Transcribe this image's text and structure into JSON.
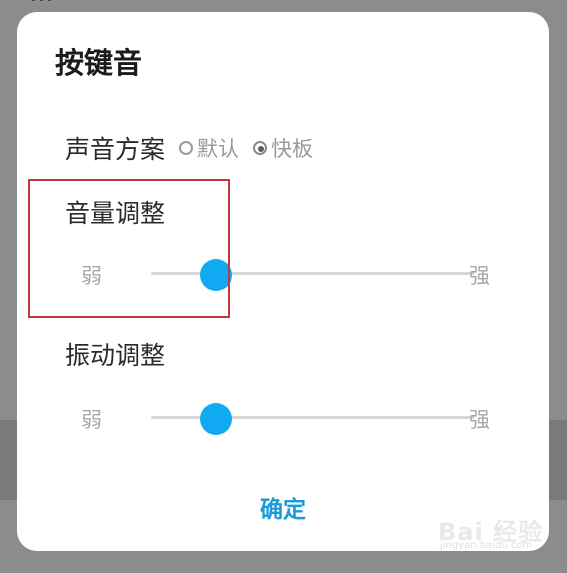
{
  "background": {
    "partial_text": "..."
  },
  "dialog": {
    "title": "按键音",
    "sound_scheme": {
      "label": "声音方案",
      "options": [
        {
          "label": "默认",
          "selected": false
        },
        {
          "label": "快板",
          "selected": true
        }
      ]
    },
    "volume": {
      "label": "音量调整",
      "min_label": "弱",
      "max_label": "强",
      "level_fraction": 0.2
    },
    "vibration": {
      "label": "振动调整",
      "min_label": "弱",
      "max_label": "强",
      "level_fraction": 0.2
    },
    "confirm_label": "确定"
  },
  "watermark": {
    "logo_text": "Bai 经验",
    "url_text": "jingyan.baidu.com"
  },
  "colors": {
    "accent": "#11a9f1",
    "confirm": "#1a9ad6",
    "highlight": "#c4363d"
  }
}
